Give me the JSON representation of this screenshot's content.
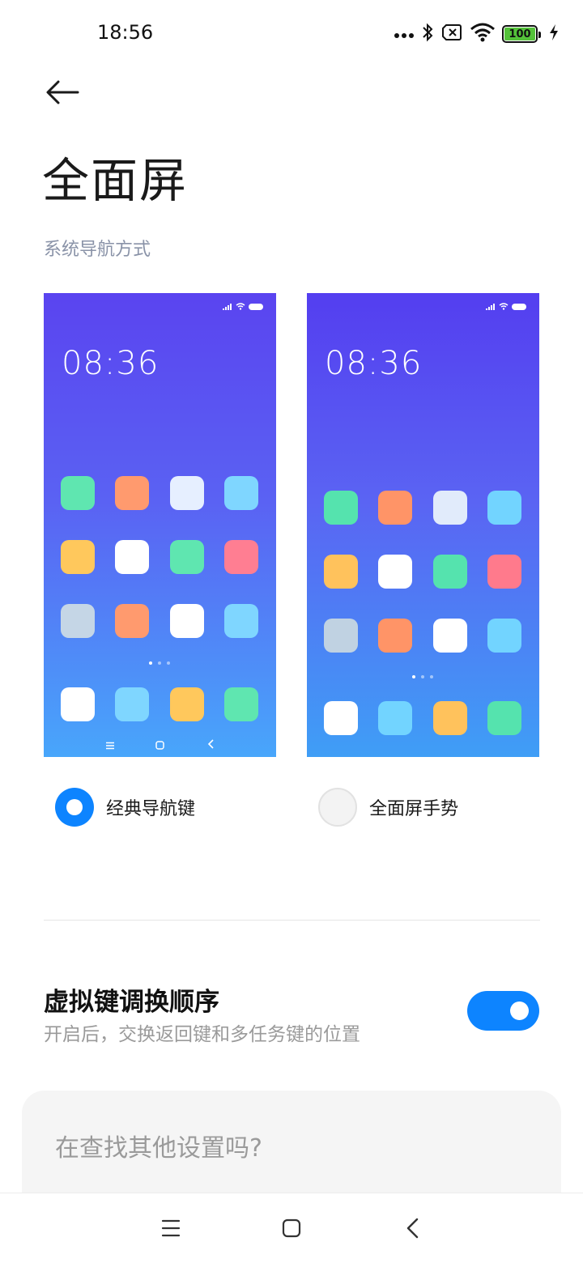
{
  "status_bar": {
    "time": "18:56",
    "battery_level": "100",
    "icons": [
      "more-dots-icon",
      "bluetooth-icon",
      "sim-none-icon",
      "wifi-icon",
      "battery-icon",
      "charging-icon"
    ]
  },
  "header": {
    "back_icon": "back-arrow-icon",
    "title": "全面屏"
  },
  "section": {
    "label": "系统导航方式"
  },
  "previews": [
    {
      "time": "08:36",
      "selected": true,
      "label": "经典导航键",
      "dock_colors": [
        "#ffffff",
        "#7fd6ff",
        "#ffc85c",
        "#5fe6b0"
      ]
    },
    {
      "time": "08:36",
      "selected": false,
      "label": "全面屏手势",
      "dock_colors": [
        "#ffffff",
        "#72d4ff",
        "#ffc25c",
        "#55e3ae"
      ]
    }
  ],
  "setting": {
    "title": "虚拟键调换顺序",
    "description": "开启后，交换返回键和多任务键的位置",
    "enabled": true
  },
  "search_card": {
    "text": "在查找其他设置吗?"
  },
  "system_nav": {
    "icons": [
      "menu-icon",
      "home-icon",
      "back-icon"
    ]
  },
  "colors": {
    "accent": "#0d84ff",
    "section_label": "#8a93a8",
    "muted_text": "#9a9a9a",
    "card_bg": "#f5f5f5"
  }
}
